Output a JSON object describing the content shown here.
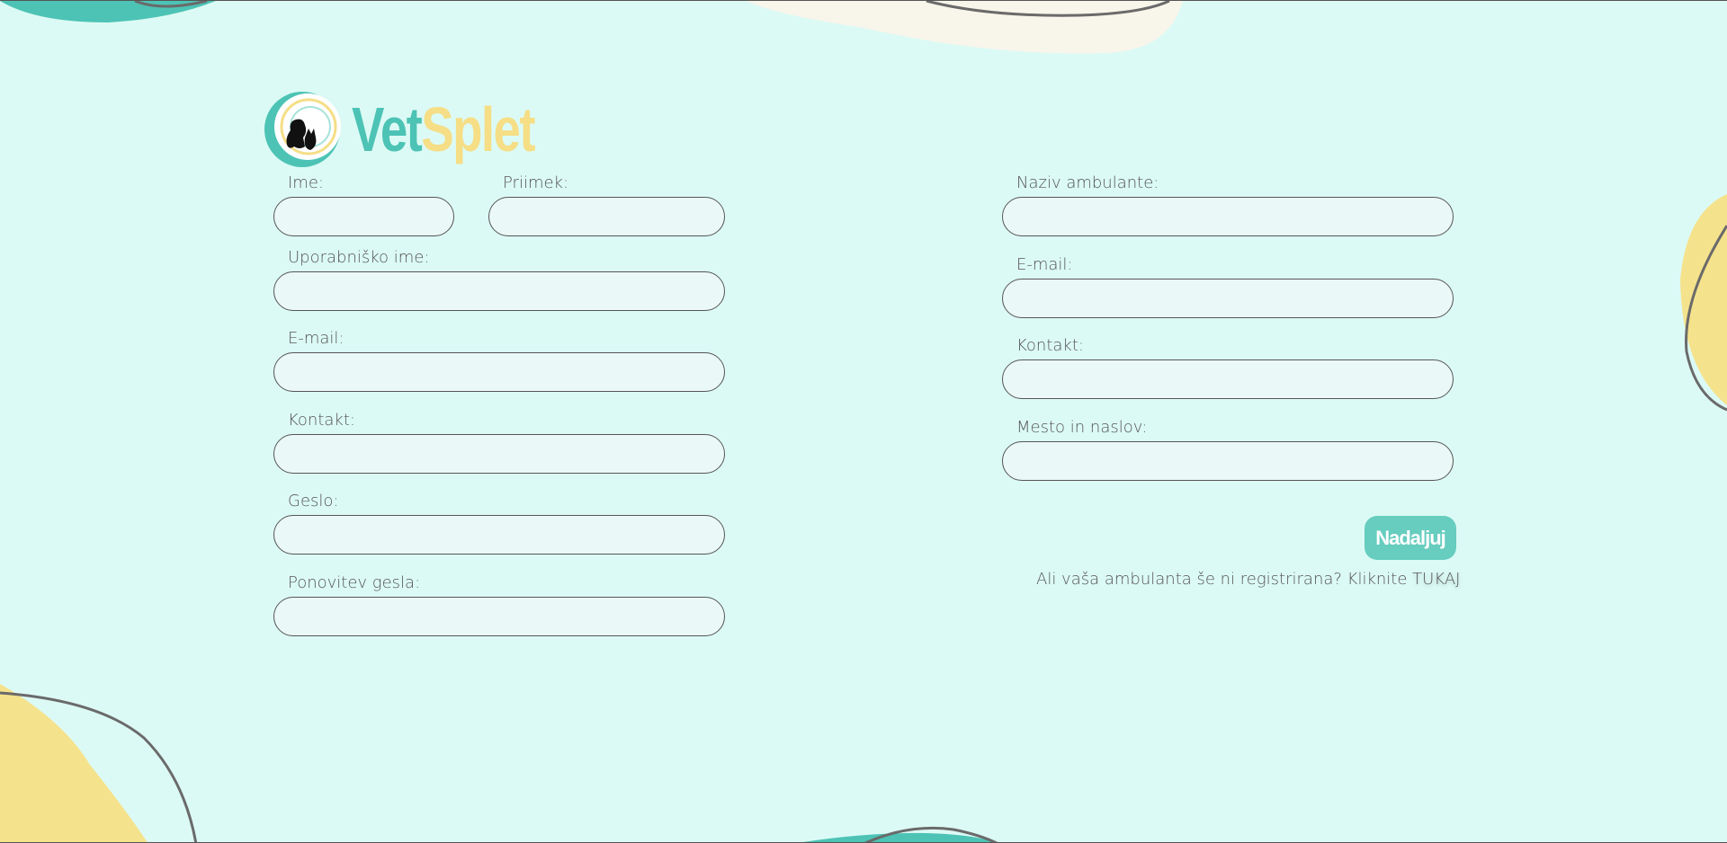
{
  "brand": {
    "part1": "Vet",
    "part2": "Splet",
    "colors": {
      "teal": "#4cc3b5",
      "yellow": "#f5de86",
      "background": "#dcfaf5"
    }
  },
  "user_form": {
    "first_name_label": "Ime:",
    "last_name_label": "Priimek:",
    "username_label": "Uporabniško ime:",
    "email_label": "E-mail:",
    "contact_label": "Kontakt:",
    "password_label": "Geslo:",
    "password_repeat_label": "Ponovitev gesla:"
  },
  "clinic_form": {
    "clinic_name_label": "Naziv ambulante:",
    "email_label": "E-mail:",
    "contact_label": "Kontakt:",
    "address_label": "Mesto in naslov:"
  },
  "actions": {
    "continue_label": "Nadaljuj",
    "register_prompt": "Ali vaša ambulanta še ni registrirana? Kliknite ",
    "register_link": "TUKAJ"
  }
}
